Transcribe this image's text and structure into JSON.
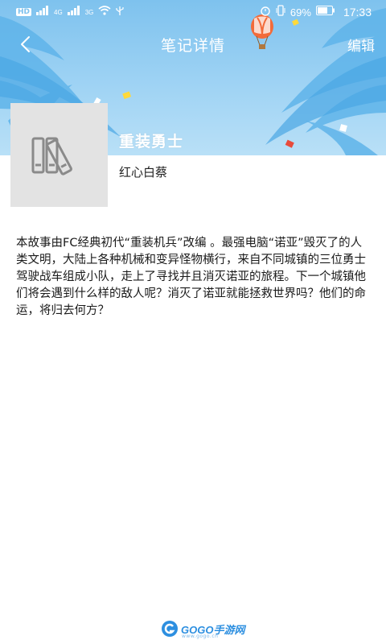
{
  "status_bar": {
    "hd_label": "HD",
    "net_4g": "4G",
    "net_3g": "3G",
    "battery": "69%",
    "time": "17:33"
  },
  "nav": {
    "back_icon": "chevron-left-icon",
    "title": "笔记详情",
    "edit_label": "编辑"
  },
  "book": {
    "cover_icon": "books-icon",
    "title": "重装勇士",
    "author": "红心白蔡"
  },
  "summary": "本故事由FC经典初代“重装机兵”改编 。最强电脑“诺亚”毁灭了的人类文明，大陆上各种机械和变异怪物横行，来自不同城镇的三位勇士驾驶战车组成小队，走上了寻找并且消灭诺亚的旅程。下一个城镇他们将会遇到什么样的敌人呢？消灭了诺亚就能拯救世界吗？他们的命运，将归去何方？",
  "watermark": {
    "text": "GOGO手游网",
    "sub": "www.gogo.cn"
  },
  "colors": {
    "banner_top": "#7ec2ee",
    "banner_bottom": "#b9e0f7",
    "cover_bg": "#e3e3e3",
    "text": "#1a1a1a"
  }
}
